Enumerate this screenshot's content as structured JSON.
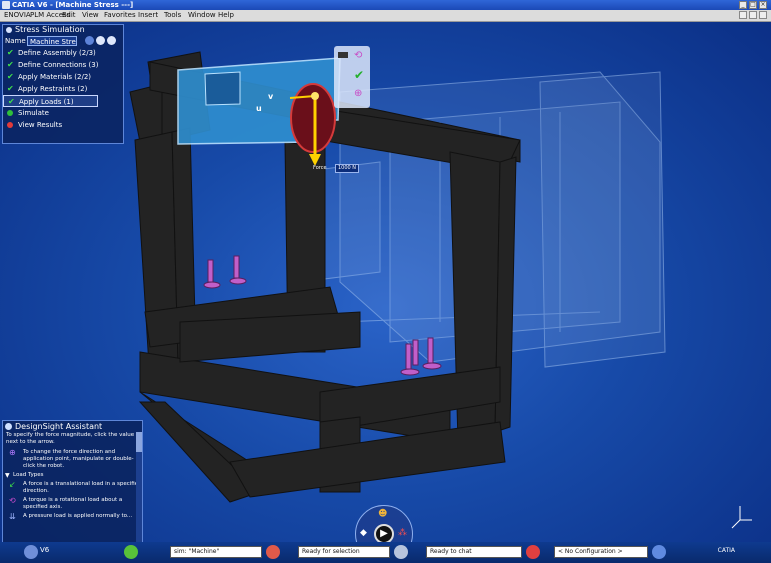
{
  "window": {
    "title": "CATIA V6 - [Machine Stress ---]"
  },
  "menu": [
    "ENOVIA",
    "PLM Access",
    "Edit",
    "View",
    "Favorites",
    "Insert",
    "Tools",
    "Window",
    "Help"
  ],
  "panel": {
    "title": "Stress Simulation",
    "name_label": "Name",
    "name_value": "Machine Stress",
    "steps": [
      {
        "label": "Define Assembly (2/3)",
        "state": "done"
      },
      {
        "label": "Define Connections (3)",
        "state": "done"
      },
      {
        "label": "Apply Materials (2/2)",
        "state": "done"
      },
      {
        "label": "Apply Restraints (2)",
        "state": "done"
      },
      {
        "label": "Apply Loads (1)",
        "state": "active"
      },
      {
        "label": "Simulate",
        "state": "pending"
      },
      {
        "label": "View Results",
        "state": "pending"
      }
    ]
  },
  "assistant": {
    "title": "DesignSight Assistant",
    "intro": "To specify the force magnitude, click the value next to the arrow.",
    "tip": "To change the force direction and application point, manipulate or double-click the robot.",
    "section": "Load Types",
    "types": [
      {
        "text": "A force is a translational load in a specified direction.",
        "color": "#3fe04a"
      },
      {
        "text": "A torque is a rotational load about a specified axis.",
        "color": "#d64fd3"
      },
      {
        "text": "A pressure load is applied normally to...",
        "color": "#9fb6ff"
      }
    ]
  },
  "viewport": {
    "force_label": "Force",
    "force_value": "1000 N",
    "axis_u": "u",
    "axis_v": "v"
  },
  "statusbar": {
    "brand": "V6",
    "search_value": "sim: \"Machine\"",
    "status": "Ready for selection",
    "chat": "Ready to chat",
    "config": "< No Configuration >",
    "logo": "CATIA"
  }
}
